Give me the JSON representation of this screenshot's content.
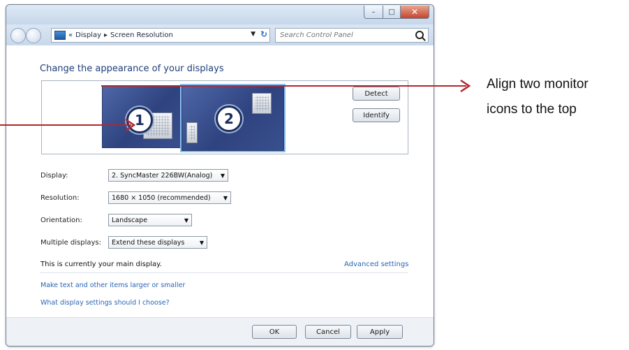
{
  "window": {
    "caption": {
      "minimize": "–",
      "maximize": "□",
      "close": "✕"
    }
  },
  "navbar": {
    "address_prefix": "«",
    "breadcrumb": [
      "Display",
      "Screen Resolution"
    ],
    "search_placeholder": "Search Control Panel"
  },
  "content": {
    "heading": "Change the appearance of your displays",
    "monitors": [
      {
        "number": "1"
      },
      {
        "number": "2"
      }
    ],
    "detect_label": "Detect",
    "identify_label": "Identify",
    "fields": {
      "display": {
        "label": "Display:",
        "value": "2. SyncMaster 226BW(Analog)"
      },
      "resolution": {
        "label": "Resolution:",
        "value": "1680 × 1050 (recommended)"
      },
      "orientation": {
        "label": "Orientation:",
        "value": "Landscape"
      },
      "multiple": {
        "label": "Multiple displays:",
        "value": "Extend these displays"
      }
    },
    "main_display_text": "This is currently your main display.",
    "advanced_link": "Advanced settings",
    "link_larger": "Make text and other items larger or smaller",
    "link_choose": "What display settings should I choose?"
  },
  "footer": {
    "ok": "OK",
    "cancel": "Cancel",
    "apply": "Apply"
  },
  "annotation": {
    "text_line1": "Align two monitor",
    "text_line2": "icons to the top",
    "arrow_color": "#b3262e"
  }
}
